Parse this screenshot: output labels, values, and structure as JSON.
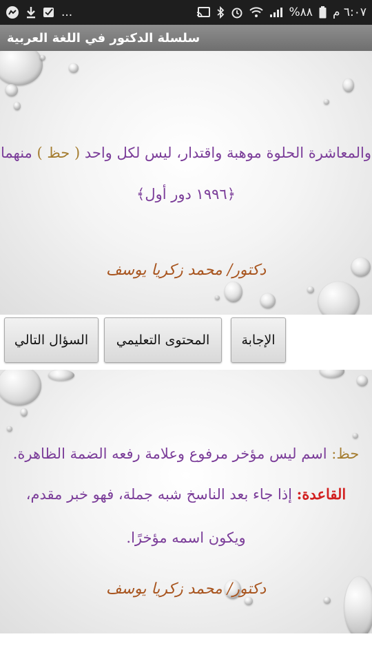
{
  "status_bar": {
    "time": "٦:٠٧ م",
    "battery": "%٨٨",
    "overflow": "...",
    "icons": [
      "messenger-icon",
      "download-icon",
      "checkbox-icon",
      "cast-icon",
      "bluetooth-icon",
      "alarm-icon",
      "wifi-icon",
      "signal-icon",
      "battery-icon"
    ]
  },
  "title_bar": {
    "title": "سلسلة الدكتور في اللغة العربية"
  },
  "question_slide": {
    "line1_pre": "والمعاشرة الحلوة موهبة واقتدار، ليس لكل واحد ",
    "line1_highlight": "( حظ )",
    "line1_post": " منهما",
    "line2": "﴿١٩٩٦ دور أول﴾",
    "signature": "دكتور/ محمد زكريا يوسف"
  },
  "buttons": {
    "answer": "الإجابة",
    "content": "المحتوى التعليمي",
    "next": "السؤال التالي"
  },
  "answer_slide": {
    "line1_label": "حظ:",
    "line1_text": " اسم ليس مؤخر مرفوع وعلامة رفعه الضمة الظاهرة.",
    "rule_label": "القاعدة:",
    "rule_text": " إذا جاء بعد الناسخ شبه جملة، فهو خبر مقدم،",
    "line3": "ويكون اسمه مؤخرًا.",
    "signature": "دكتور/ محمد زكريا يوسف"
  },
  "colors": {
    "status_bar_bg": "#1e1e1e",
    "title_bar_bg": "#7f7f7f",
    "text_purple": "#7b3d99",
    "highlight_gold": "#a57d30",
    "rule_red": "#d22020",
    "signature_brown": "#a8551f"
  }
}
